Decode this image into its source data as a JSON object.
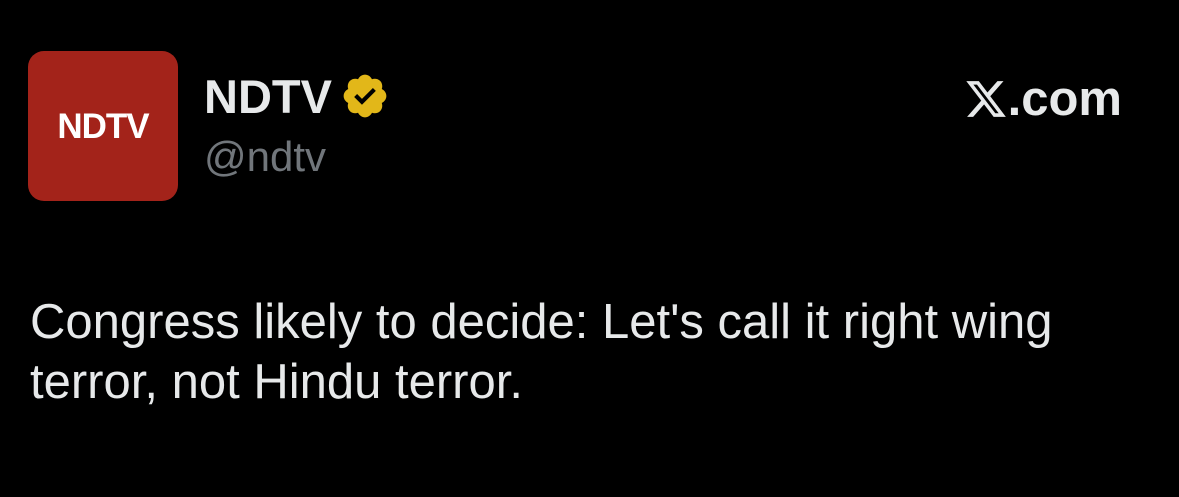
{
  "author": {
    "avatar_text": "NDTV",
    "display_name": "NDTV",
    "handle": "@ndtv",
    "verified_icon": "verified-gold-badge-icon"
  },
  "source": {
    "logo_icon": "x-logo-icon",
    "domain": ".com"
  },
  "tweet": {
    "text": "Congress likely to decide: Let's call it right wing terror, not Hindu terror."
  },
  "colors": {
    "background": "#000000",
    "avatar_bg": "#a3231a",
    "badge_gold": "#e2b719",
    "text_primary": "#e7e9ea",
    "text_secondary": "#71767b"
  }
}
